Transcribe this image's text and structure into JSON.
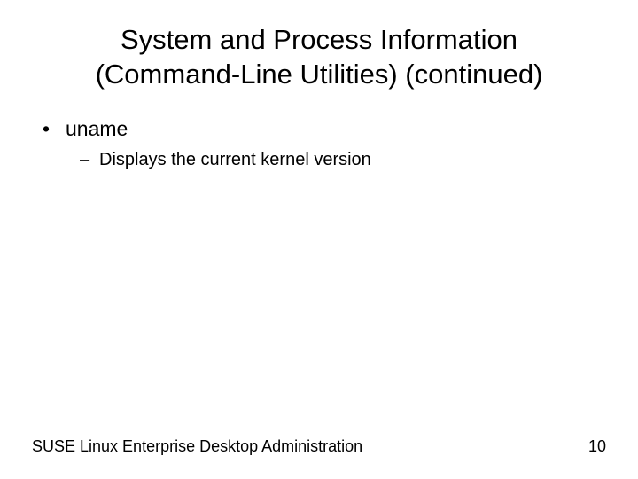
{
  "title_line1": "System and Process Information",
  "title_line2": "(Command-Line Utilities) (continued)",
  "bullets": [
    {
      "text": "uname",
      "subs": [
        "Displays the current kernel version"
      ]
    }
  ],
  "footer_text": "SUSE Linux Enterprise Desktop Administration",
  "page_number": "10"
}
